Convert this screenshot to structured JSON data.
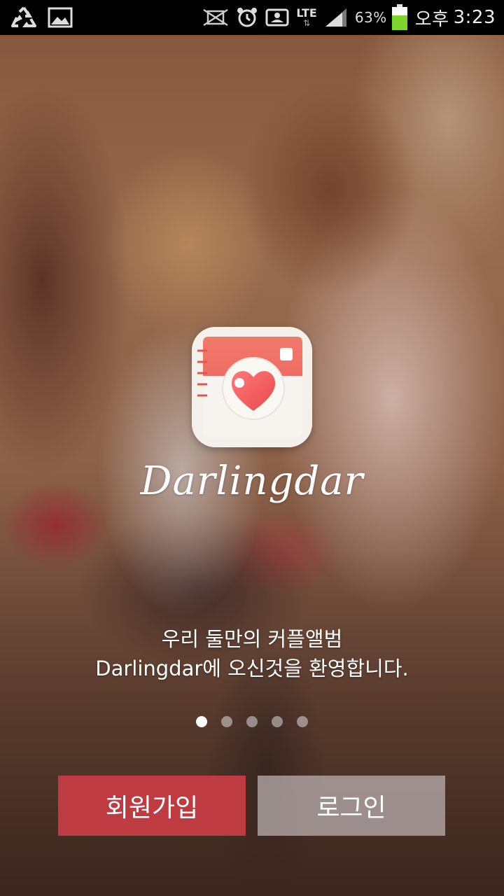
{
  "status_bar": {
    "icons_left": [
      "recycle-icon",
      "image-icon"
    ],
    "icons_right": [
      "nfc-icon",
      "alarm-icon",
      "sync-icon",
      "lte-signal-icon",
      "battery-icon"
    ],
    "network": "LTE",
    "battery_percent": "63%",
    "ampm": "오후",
    "time": "3:23",
    "battery_color": "#7fd62a"
  },
  "app": {
    "name": "Darlingdar",
    "icon": "heart-camera-app-icon",
    "accent_color": "#f06a6a"
  },
  "tagline": {
    "line1": "우리 둘만의 커플앨범",
    "line2": "Darlingdar에 오신것을 환영합니다."
  },
  "pager": {
    "count": 5,
    "active_index": 0
  },
  "buttons": {
    "signup_label": "회원가입",
    "login_label": "로그인",
    "signup_color": "#bf3b42"
  }
}
